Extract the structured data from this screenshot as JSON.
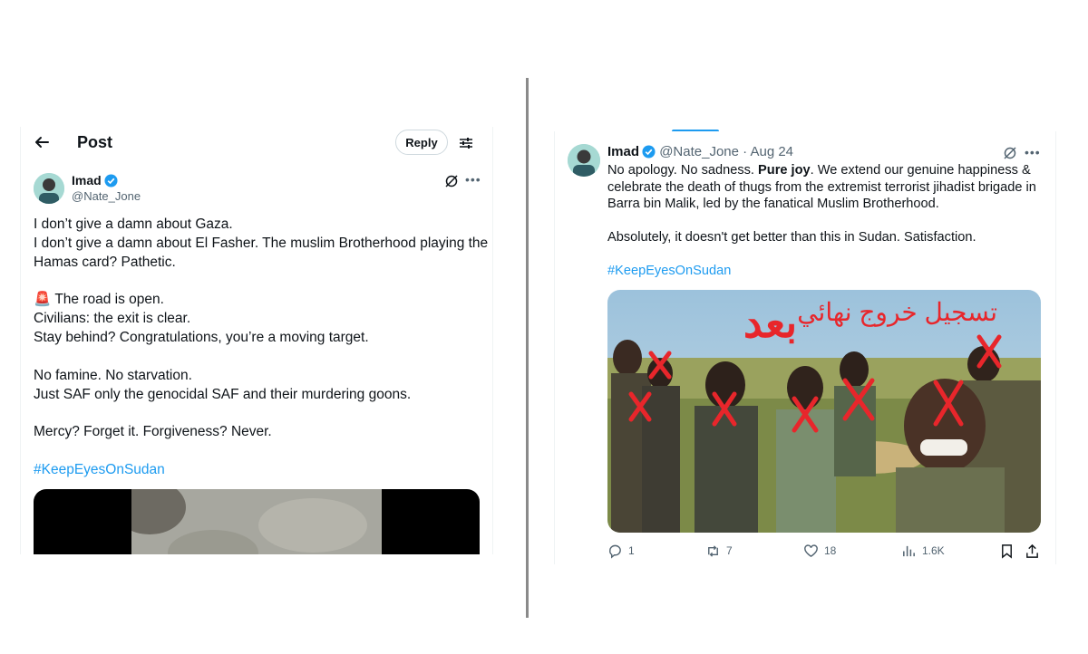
{
  "left": {
    "header": {
      "title": "Post",
      "reply_label": "Reply"
    },
    "author": {
      "name": "Imad",
      "handle": "@Nate_Jone"
    },
    "lines": [
      "I don’t give a damn about Gaza.",
      "I don’t give a damn about El Fasher. The muslim Brotherhood playing the",
      "Hamas card? Pathetic.",
      "🚨 The road is open.",
      "Civilians: the exit is clear.",
      "Stay behind? Congratulations, you’re a moving target.",
      "No famine. No starvation.",
      "Just SAF only the genocidal SAF and their murdering goons.",
      "Mercy? Forget it. Forgiveness? Never."
    ],
    "hashtag": "#KeepEyesOnSudan"
  },
  "right": {
    "author": {
      "name": "Imad",
      "handle": "@Nate_Jone",
      "sep": "·",
      "date": "Aug 24"
    },
    "para1": {
      "a": "No apology. No sadness. ",
      "bold": "Pure joy",
      "b": ". We extend our genuine happiness &",
      "line2": "celebrate the death of thugs from the extremist terrorist jihadist brigade in",
      "line3": "Barra bin Malik, led by the fanatical Muslim Brotherhood."
    },
    "para2": "Absolutely, it doesn't get better than this in Sudan. Satisfaction.",
    "hashtag": "#KeepEyesOnSudan",
    "photo_text": {
      "arabic_caption": "تسجيل خروج نهائي",
      "stamp": "بعد"
    },
    "actions": {
      "replies": "1",
      "reposts": "7",
      "likes": "18",
      "views": "1.6K"
    }
  },
  "colors": {
    "link": "#1d9bf0",
    "verified": "#1d9bf0",
    "muted": "#536471",
    "red_mark": "#e8262b"
  }
}
